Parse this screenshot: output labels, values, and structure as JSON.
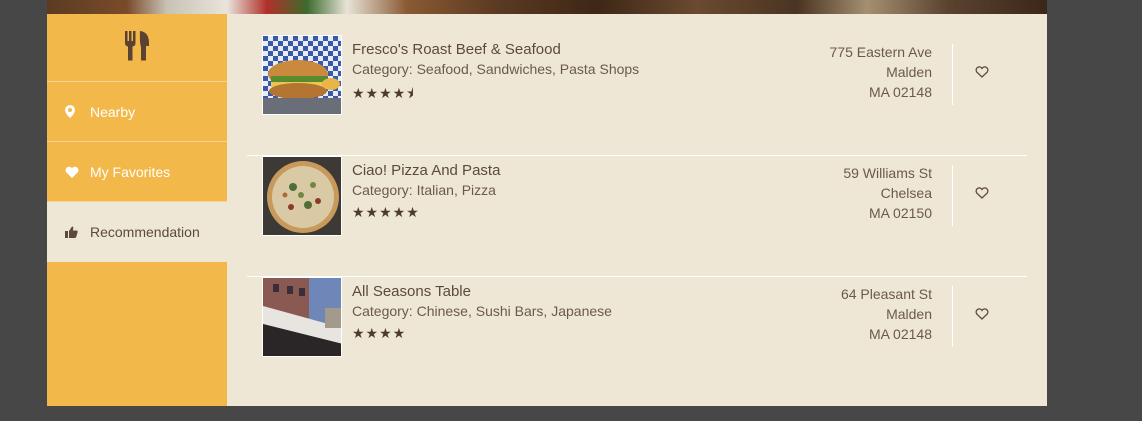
{
  "sidebar": {
    "logo_icon": "fork-knife-icon",
    "items": [
      {
        "label": "Nearby",
        "icon": "map-pin-icon"
      },
      {
        "label": "My Favorites",
        "icon": "heart-icon"
      },
      {
        "label": "Recommendation",
        "icon": "thumbs-up-icon",
        "active": true
      }
    ]
  },
  "colors": {
    "sidebar": "#f2b84a",
    "panel": "#efe7d6",
    "text": "#5c4a3d",
    "background": "#474747"
  },
  "restaurants": [
    {
      "name": "Fresco's Roast Beef & Seafood",
      "category": "Category: Seafood, Sandwiches, Pasta Shops",
      "rating": 4.5,
      "stars": "★★★★⯨",
      "address": {
        "street": "775 Eastern Ave",
        "city": "Malden",
        "statezip": "MA 02148"
      }
    },
    {
      "name": "Ciao! Pizza And Pasta",
      "category": "Category: Italian, Pizza",
      "rating": 5,
      "stars": "★★★★★",
      "address": {
        "street": "59 Williams St",
        "city": "Chelsea",
        "statezip": "MA 02150"
      }
    },
    {
      "name": "All Seasons Table",
      "category": "Category: Chinese, Sushi Bars, Japanese",
      "rating": 4,
      "stars": "★★★★",
      "address": {
        "street": "64 Pleasant St",
        "city": "Malden",
        "statezip": "MA 02148"
      }
    }
  ]
}
